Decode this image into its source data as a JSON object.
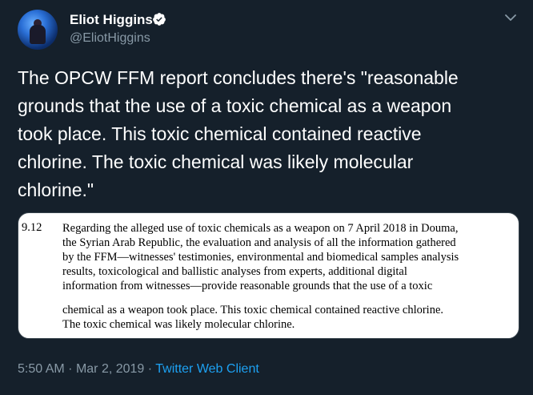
{
  "author": {
    "name": "Eliot Higgins",
    "handle": "@EliotHiggins",
    "verified_icon": "verified-badge-icon",
    "avatar_icon": "avatar-image"
  },
  "tweet": {
    "text_lines": [
      "The OPCW FFM report concludes there's \"reasonable",
      "grounds that the use of a toxic chemical as a weapon",
      "took place. This toxic chemical contained reactive",
      "chlorine. The toxic chemical was likely molecular",
      "chlorine.\""
    ]
  },
  "media": {
    "section_number": "9.12",
    "paragraph_lines": [
      "Regarding the alleged use of toxic chemicals as a weapon on 7 April 2018 in Douma,",
      "the Syrian Arab Republic, the evaluation and analysis of all the information gathered",
      "by the FFM—witnesses' testimonies, environmental and biomedical samples analysis",
      "results, toxicological and ballistic analyses from experts, additional digital",
      "information from witnesses—provide reasonable grounds that the use of a toxic"
    ],
    "paragraph_lines_2": [
      "chemical as a weapon took place. This toxic chemical contained reactive chlorine.",
      "The toxic chemical was likely molecular chlorine."
    ]
  },
  "meta": {
    "time": "5:50 AM",
    "separator": "·",
    "date": "Mar 2, 2019",
    "source": "Twitter Web Client"
  },
  "menu_icon": "chevron-down-icon",
  "colors": {
    "background": "#15202b",
    "text": "#ffffff",
    "secondary": "#8899a6",
    "accent": "#1da1f2",
    "border": "#38444d"
  }
}
